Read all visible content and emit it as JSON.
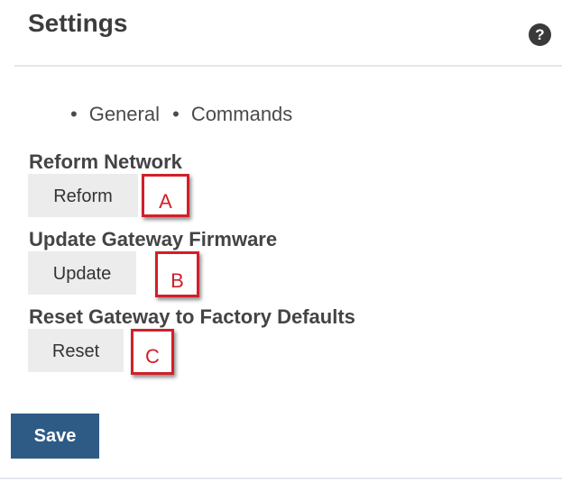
{
  "header": {
    "title": "Settings",
    "help_icon_glyph": "?"
  },
  "tabs": [
    {
      "label": "General",
      "bullet": "•"
    },
    {
      "label": "Commands",
      "bullet": "•"
    }
  ],
  "sections": [
    {
      "label": "Reform Network",
      "button_label": "Reform",
      "callout": "A"
    },
    {
      "label": "Update Gateway Firmware",
      "button_label": "Update",
      "callout": "B"
    },
    {
      "label": "Reset Gateway to Factory Defaults",
      "button_label": "Reset",
      "callout": "C"
    }
  ],
  "footer": {
    "save_label": "Save"
  },
  "colors": {
    "save_button": "#2e5b86",
    "callout_border": "#d0202a",
    "command_button_bg": "#ececec",
    "help_icon_bg": "#3a3a3a"
  },
  "icons": {
    "help": "help-icon"
  }
}
